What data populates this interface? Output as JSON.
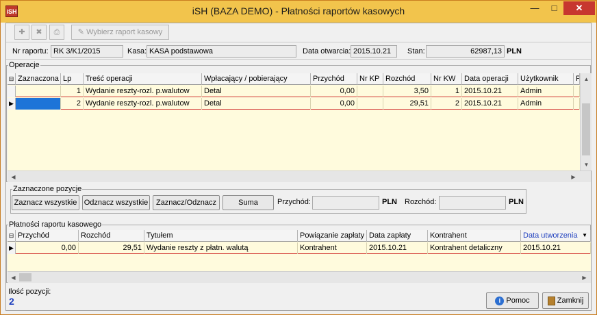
{
  "window": {
    "title": "iSH (BAZA DEMO) - Płatności raportów kasowych",
    "app_icon_text": "iSH",
    "minimize_icon": "minimize-icon",
    "maximize_icon": "maximize-icon",
    "close_icon": "close-icon"
  },
  "toolbar": {
    "add_icon": "add-icon",
    "delete_icon": "delete-icon",
    "print_icon": "print-icon",
    "choose_report_label": "Wybierz raport kasowy"
  },
  "header": {
    "nr_raportu_label": "Nr raportu:",
    "nr_raportu_value": "RK 3/K1/2015",
    "kasa_label": "Kasa:",
    "kasa_value": "KASA podstawowa",
    "data_otwarcia_label": "Data otwarcia:",
    "data_otwarcia_value": "2015.10.21",
    "stan_label": "Stan:",
    "stan_value": "62987,13",
    "currency": "PLN"
  },
  "operations": {
    "title": "Operacje",
    "columns": [
      "Zaznaczona",
      "Lp",
      "Treść operacji",
      "Wpłacający / pobierający",
      "Przychód",
      "Nr KP",
      "Rozchód",
      "Nr KW",
      "Data operacji",
      "Użytkownik",
      "P"
    ],
    "rows": [
      [
        "",
        "1",
        "Wydanie reszty-rozl. p.walutow",
        "Detal",
        "0,00",
        "",
        "3,50",
        "1",
        "2015.10.21",
        "Admin",
        ""
      ],
      [
        "",
        "2",
        "Wydanie reszty-rozl. p.walutow",
        "Detal",
        "0,00",
        "",
        "29,51",
        "2",
        "2015.10.21",
        "Admin",
        ""
      ]
    ]
  },
  "selected_positions": {
    "title": "Zaznaczone pozycje",
    "select_all": "Zaznacz wszystkie",
    "deselect_all": "Odznacz wszystkie",
    "toggle": "Zaznacz/Odznacz",
    "sum": "Suma",
    "przychod_label": "Przychód:",
    "rozchod_label": "Rozchód:",
    "currency": "PLN"
  },
  "payments": {
    "title": "Płatności raportu kasowego",
    "columns": [
      "Przychód",
      "Rozchód",
      "Tytułem",
      "Powiązanie zapłaty",
      "Data zapłaty",
      "Kontrahent",
      "Data utworzenia"
    ],
    "rows": [
      [
        "0,00",
        "29,51",
        "Wydanie reszty z płatn. walutą",
        "Kontrahent",
        "2015.10.21",
        "Kontrahent detaliczny",
        "2015.10.21"
      ]
    ]
  },
  "footer": {
    "count_label": "Ilość pozycji:",
    "count_value": "2",
    "help_label": "Pomoc",
    "close_label": "Zamknij"
  },
  "colors": {
    "titlebar": "#f2c44c",
    "grid_bg": "#fffbdd",
    "row_line": "#d0302c",
    "selection": "#1d74d8",
    "sorted_header": "#1e3fbe"
  }
}
